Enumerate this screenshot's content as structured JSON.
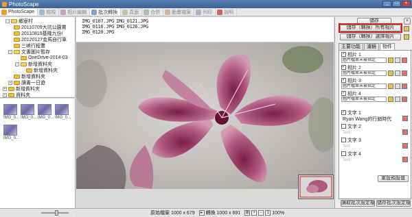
{
  "window": {
    "title": "PhotoScape"
  },
  "tabs": [
    "PhotoScape",
    "檢視",
    "相片編輯",
    "批次轉換",
    "頁面",
    "合併",
    "動畫檔案",
    "列印",
    "說明"
  ],
  "tree": [
    {
      "label": "鄉寮村",
      "level": 1,
      "open": true
    },
    {
      "label": "20110709大坑公園賞",
      "level": 2
    },
    {
      "label": "20110819基隆九份/",
      "level": 2
    },
    {
      "label": "20120127金馬自行車",
      "level": 2
    },
    {
      "label": "三峽行程畫",
      "level": 2
    },
    {
      "label": "文書圖片暫存",
      "level": 2,
      "open": true
    },
    {
      "label": "OneDrive-2014-03",
      "level": 3
    },
    {
      "label": "新增資料夾",
      "level": 3
    },
    {
      "label": "新增資料夾",
      "level": 4
    },
    {
      "label": "新增資料夾",
      "level": 2
    },
    {
      "label": "讀書一日遊",
      "level": 2
    },
    {
      "label": "新增資料夾",
      "level": 1
    },
    {
      "label": "資料夾",
      "level": 1
    }
  ],
  "thumbnails": [
    "IMG_0...",
    "IMG_0...",
    "IMG_0...",
    "IMG_0...",
    "IMG_0..."
  ],
  "files": {
    "col1": [
      "IMG_0107.JPG",
      "IMG_0116.JPG",
      "IMG_0120.JPG"
    ],
    "col2": [
      "IMG_0121.JPG",
      "IMG_0126.JPG"
    ]
  },
  "status": {
    "original": "原始檔案 1000 x 679",
    "converted": "轉換 1000 x 691",
    "zoom": "100%"
  },
  "panel": {
    "save_button": "儲存",
    "close_button": "×",
    "convert_all": "儲存（轉換）所有相片",
    "convert_select": "儲存（轉換）選擇相片",
    "tabs": [
      "主要功能",
      "濾鏡",
      "物件"
    ],
    "photos": [
      {
        "label": "相片 1",
        "checked": true,
        "file": "圖片檔案未被指定"
      },
      {
        "label": "相片 2",
        "checked": true,
        "file": "圖片檔案未被指定"
      },
      {
        "label": "相片 3",
        "checked": true,
        "file": "圖片檔案未被指定"
      },
      {
        "label": "相片 4",
        "checked": true,
        "file": "圖片檔案未被指定"
      }
    ],
    "texts": [
      {
        "label": "文字 1",
        "checked": true,
        "value": "Ryan Wang的行銷時代"
      },
      {
        "label": "文字 2",
        "checked": false,
        "value": "Text"
      },
      {
        "label": "文字 3",
        "checked": false,
        "value": "Text"
      },
      {
        "label": "文字 4",
        "checked": false,
        "value": "Text"
      }
    ],
    "reset_button": "重設預設值",
    "load_button": "讀取批次設定檔",
    "save_settings_button": "儲存批次設定檔"
  }
}
